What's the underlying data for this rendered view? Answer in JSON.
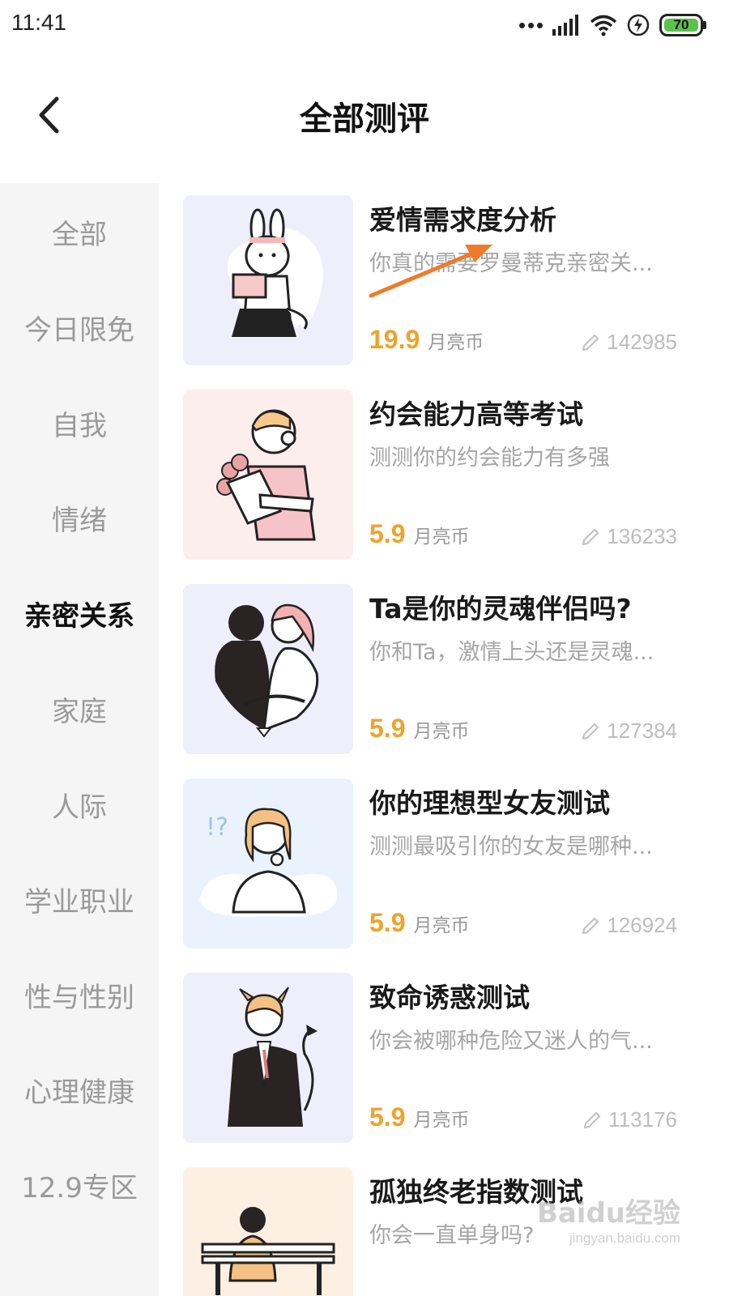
{
  "status_bar": {
    "time": "11:41",
    "battery": "70"
  },
  "header": {
    "title": "全部测评"
  },
  "sidebar": {
    "items": [
      {
        "label": "全部"
      },
      {
        "label": "今日限免"
      },
      {
        "label": "自我"
      },
      {
        "label": "情绪"
      },
      {
        "label": "亲密关系"
      },
      {
        "label": "家庭"
      },
      {
        "label": "人际"
      },
      {
        "label": "学业职业"
      },
      {
        "label": "性与性别"
      },
      {
        "label": "心理健康"
      },
      {
        "label": "12.9专区"
      }
    ],
    "active": "亲密关系"
  },
  "tests": [
    {
      "title": "爱情需求度分析",
      "desc": "你真的需要罗曼蒂克亲密关...",
      "price": "19.9",
      "currency": "月亮币",
      "count": "142985",
      "thumb_bg": "#efeefb"
    },
    {
      "title": "约会能力高等考试",
      "desc": "测测你的约会能力有多强",
      "price": "5.9",
      "currency": "月亮币",
      "count": "136233",
      "thumb_bg": "#fdeeee"
    },
    {
      "title": "Ta是你的灵魂伴侣吗?",
      "desc": "你和Ta，激情上头还是灵魂...",
      "price": "5.9",
      "currency": "月亮币",
      "count": "127384",
      "thumb_bg": "#efeefb"
    },
    {
      "title": "你的理想型女友测试",
      "desc": "测测最吸引你的女友是哪种...",
      "price": "5.9",
      "currency": "月亮币",
      "count": "126924",
      "thumb_bg": "#eaf3fd"
    },
    {
      "title": "致命诱惑测试",
      "desc": "你会被哪种危险又迷人的气...",
      "price": "5.9",
      "currency": "月亮币",
      "count": "113176",
      "thumb_bg": "#efeefb"
    },
    {
      "title": "孤独终老指数测试",
      "desc": "你会一直单身吗?",
      "price": "",
      "currency": "",
      "count": "",
      "thumb_bg": "#fdf0e2"
    }
  ],
  "watermark": {
    "main": "Baidu经验",
    "sub": "jingyan.baidu.com"
  },
  "colors": {
    "accent_price": "#f0a22a",
    "annotation_arrow": "#f07a2a",
    "sidebar_bg": "#f5f5f5"
  }
}
